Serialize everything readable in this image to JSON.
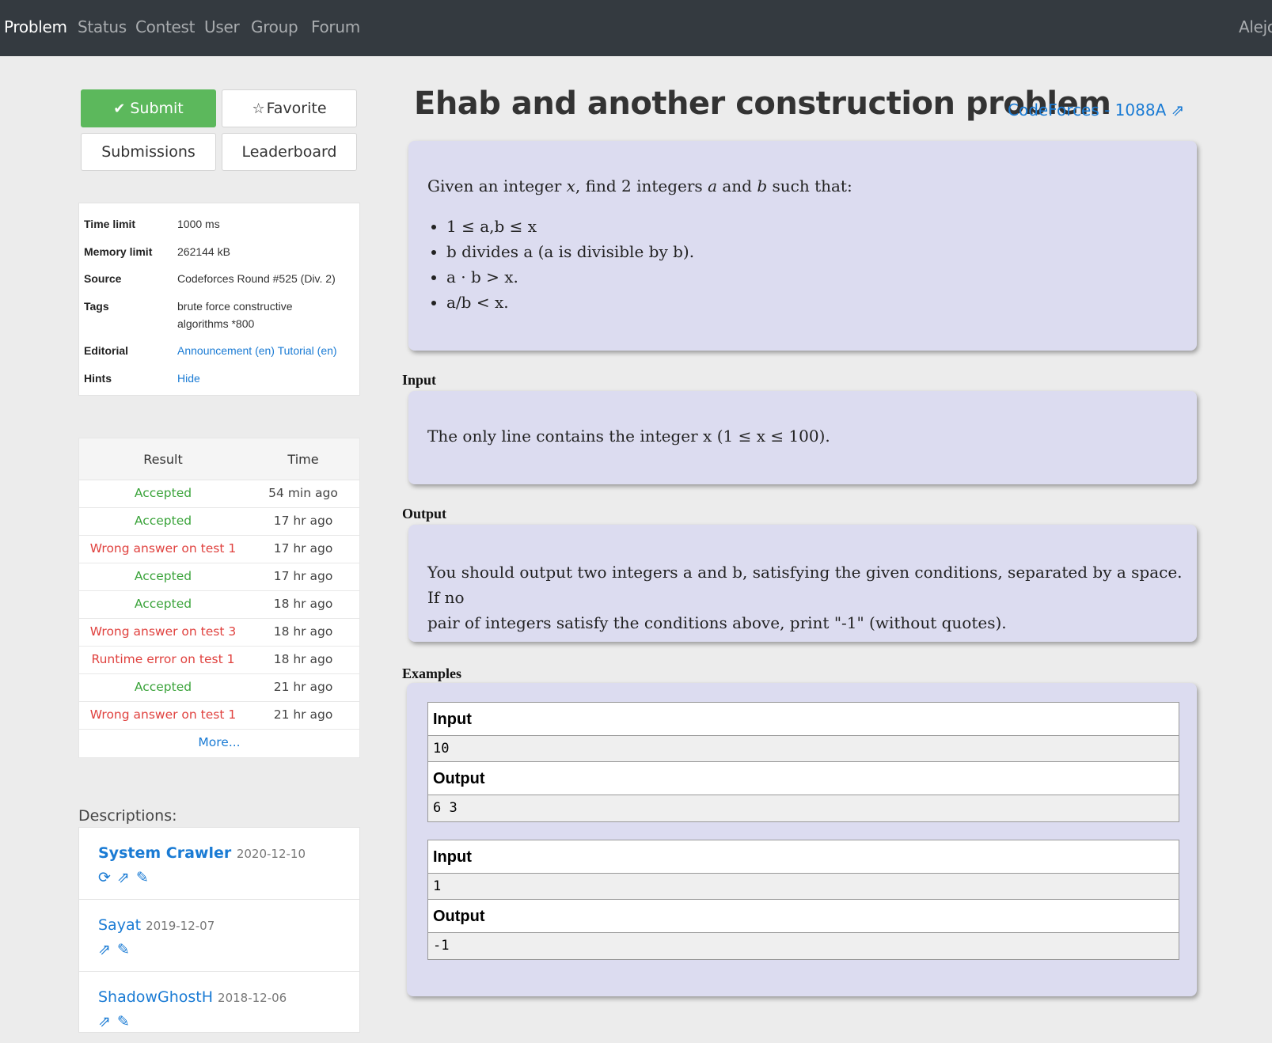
{
  "nav": {
    "items": [
      "Problem",
      "Status",
      "Contest",
      "User",
      "Group",
      "Forum"
    ],
    "user": "Alejo"
  },
  "actions": {
    "submit": "Submit",
    "favorite": "Favorite",
    "submissions": "Submissions",
    "leaderboard": "Leaderboard"
  },
  "info": {
    "time_limit_label": "Time limit",
    "time_limit": "1000 ms",
    "memory_limit_label": "Memory limit",
    "memory_limit": "262144 kB",
    "source_label": "Source",
    "source": "Codeforces Round #525 (Div. 2)",
    "tags_label": "Tags",
    "tags_line1": "brute force constructive",
    "tags_line2": "algorithms *800",
    "editorial_label": "Editorial",
    "editorial_1": "Announcement (en)",
    "editorial_2": "Tutorial (en)",
    "hints_label": "Hints",
    "hints": "Hide"
  },
  "results": {
    "col_result": "Result",
    "col_time": "Time",
    "rows": [
      {
        "result": "Accepted",
        "time": "54 min ago",
        "status": "ok"
      },
      {
        "result": "Accepted",
        "time": "17 hr ago",
        "status": "ok"
      },
      {
        "result": "Wrong answer on test 1",
        "time": "17 hr ago",
        "status": "bad"
      },
      {
        "result": "Accepted",
        "time": "17 hr ago",
        "status": "ok"
      },
      {
        "result": "Accepted",
        "time": "18 hr ago",
        "status": "ok"
      },
      {
        "result": "Wrong answer on test 3",
        "time": "18 hr ago",
        "status": "bad"
      },
      {
        "result": "Runtime error on test 1",
        "time": "18 hr ago",
        "status": "bad"
      },
      {
        "result": "Accepted",
        "time": "21 hr ago",
        "status": "ok"
      },
      {
        "result": "Wrong answer on test 1",
        "time": "21 hr ago",
        "status": "bad"
      }
    ],
    "more": "More..."
  },
  "descriptions": {
    "heading": "Descriptions:",
    "items": [
      {
        "name": "System Crawler",
        "date": "2020-12-10"
      },
      {
        "name": "Sayat",
        "date": "2019-12-07"
      },
      {
        "name": "ShadowGhostH",
        "date": "2018-12-06"
      }
    ]
  },
  "problem": {
    "title": "Ehab and another construction problem",
    "source_link": "CodeForces - 1088A",
    "statement_intro_1": "Given an integer ",
    "statement_x": "x",
    "statement_intro_2": ", find 2 integers ",
    "statement_a": "a",
    "statement_and": " and ",
    "statement_b": "b",
    "statement_intro_3": " such that:",
    "conditions": [
      "1 ≤ a,b ≤ x",
      "b divides a (a is divisible by b).",
      "a · b > x.",
      "a/b < x."
    ],
    "input_label": "Input",
    "input_text": "The only line contains the integer x (1 ≤ x ≤ 100).",
    "output_label": "Output",
    "output_text_1": "You should output two integers a and b, satisfying the given conditions, separated by a space. If no",
    "output_text_2": "pair of integers satisfy the conditions above, print \"-1\" (without quotes).",
    "examples_label": "Examples",
    "examples": [
      {
        "in_label": "Input",
        "in": "10",
        "out_label": "Output",
        "out": "6 3"
      },
      {
        "in_label": "Input",
        "in": "1",
        "out_label": "Output",
        "out": "-1"
      }
    ]
  }
}
